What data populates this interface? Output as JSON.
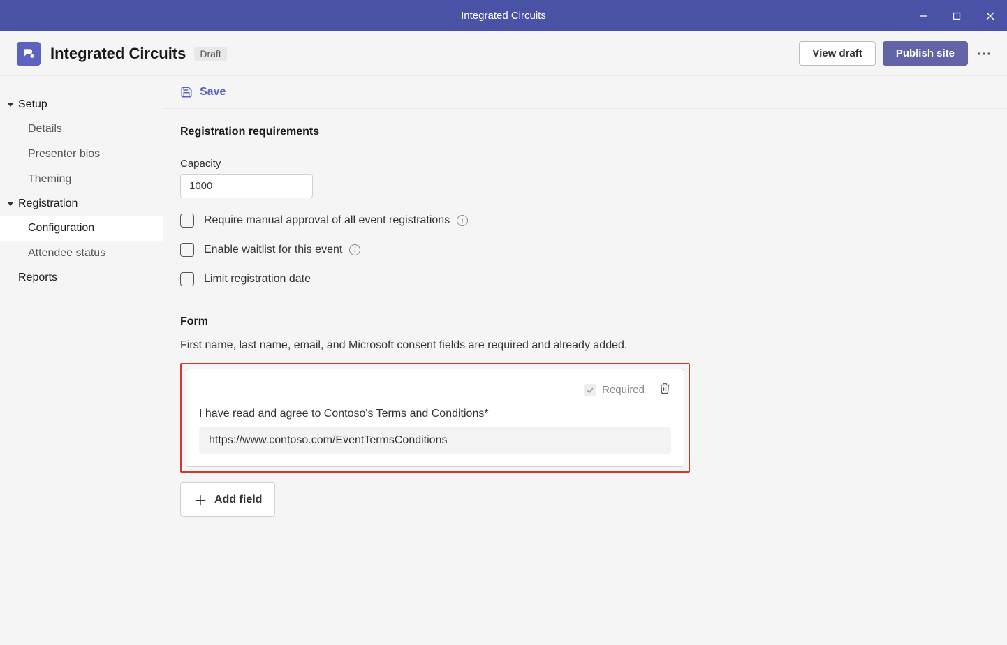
{
  "window": {
    "title": "Integrated Circuits"
  },
  "header": {
    "page_title": "Integrated Circuits",
    "status_badge": "Draft",
    "view_draft": "View draft",
    "publish": "Publish site"
  },
  "sidebar": {
    "setup": {
      "label": "Setup",
      "items": [
        "Details",
        "Presenter bios",
        "Theming"
      ]
    },
    "registration": {
      "label": "Registration",
      "items": [
        "Configuration",
        "Attendee status"
      ]
    },
    "reports": {
      "label": "Reports"
    }
  },
  "savebar": {
    "save": "Save"
  },
  "registration_req": {
    "heading": "Registration requirements",
    "capacity_label": "Capacity",
    "capacity_value": "1000",
    "chk_manual": "Require manual approval of all event registrations",
    "chk_waitlist": "Enable waitlist for this event",
    "chk_limitdate": "Limit registration date"
  },
  "form": {
    "heading": "Form",
    "desc": "First name, last name, email, and Microsoft consent fields are required and already added.",
    "required_label": "Required",
    "field_text": "I have read and agree to Contoso's Terms and Conditions*",
    "field_url": "https://www.contoso.com/EventTermsConditions",
    "add_field": "Add field"
  }
}
